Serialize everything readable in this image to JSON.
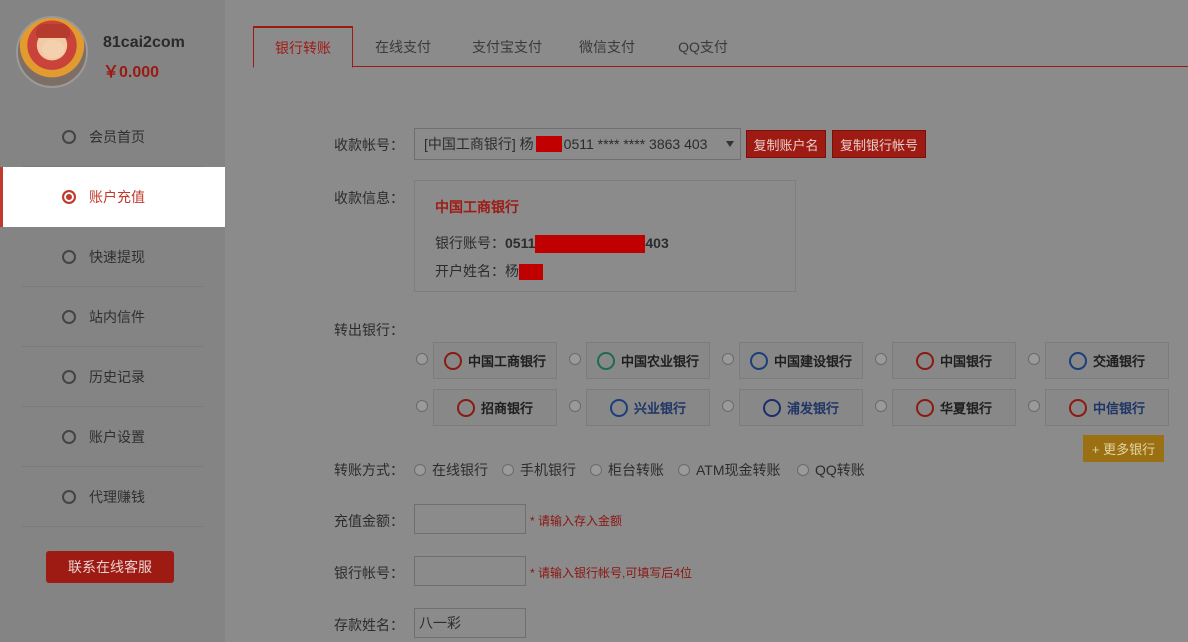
{
  "user": {
    "name": "81cai2com",
    "balance": "￥0.000"
  },
  "sidebar": {
    "items": [
      {
        "label": "会员首页",
        "icon": "home-icon"
      },
      {
        "label": "账户充值",
        "icon": "deposit-icon",
        "active": true
      },
      {
        "label": "快速提现",
        "icon": "withdraw-icon"
      },
      {
        "label": "站内信件",
        "icon": "mail-icon"
      },
      {
        "label": "历史记录",
        "icon": "history-icon"
      },
      {
        "label": "账户设置",
        "icon": "settings-icon"
      },
      {
        "label": "代理赚钱",
        "icon": "agent-icon"
      }
    ],
    "service_button": "联系在线客服"
  },
  "tabs": [
    {
      "label": "银行转账",
      "active": true
    },
    {
      "label": "在线支付"
    },
    {
      "label": "支付宝支付"
    },
    {
      "label": "微信支付"
    },
    {
      "label": "QQ支付"
    }
  ],
  "form": {
    "receive_account_label": "收款帐号：",
    "receive_account_value_pre": "[中国工商银行] 杨",
    "receive_account_value_post": "0511 **** **** 3863 403",
    "copy_name_button": "复制账户名",
    "copy_account_button": "复制银行帐号",
    "receive_info_label": "收款信息：",
    "info_bank": "中国工商银行",
    "info_account_label": "银行账号：",
    "info_account_pre": "0511",
    "info_account_post": "403",
    "info_name_label": "开户姓名：",
    "info_name_pre": "杨",
    "out_bank_label": "转出银行：",
    "banks": [
      {
        "name": "中国工商银行"
      },
      {
        "name": "中国农业银行"
      },
      {
        "name": "中国建设银行"
      },
      {
        "name": "中国银行"
      },
      {
        "name": "交通银行"
      },
      {
        "name": "招商银行"
      },
      {
        "name": "兴业银行"
      },
      {
        "name": "浦发银行"
      },
      {
        "name": "华夏银行"
      },
      {
        "name": "中信银行"
      }
    ],
    "more_banks_button": "+ 更多银行",
    "method_label": "转账方式：",
    "methods": [
      "在线银行",
      "手机银行",
      "柜台转账",
      "ATM现金转账",
      "QQ转账"
    ],
    "amount_label": "充值金额：",
    "amount_hint": "* 请输入存入金额",
    "bank_no_label": "银行帐号：",
    "bank_no_hint": "* 请输入银行帐号,可填写后4位",
    "depositor_label": "存款姓名：",
    "depositor_value": "八一彩"
  },
  "colors": {
    "accent": "#9e1b14",
    "gold": "#9a7012",
    "redact": "#c00000"
  }
}
